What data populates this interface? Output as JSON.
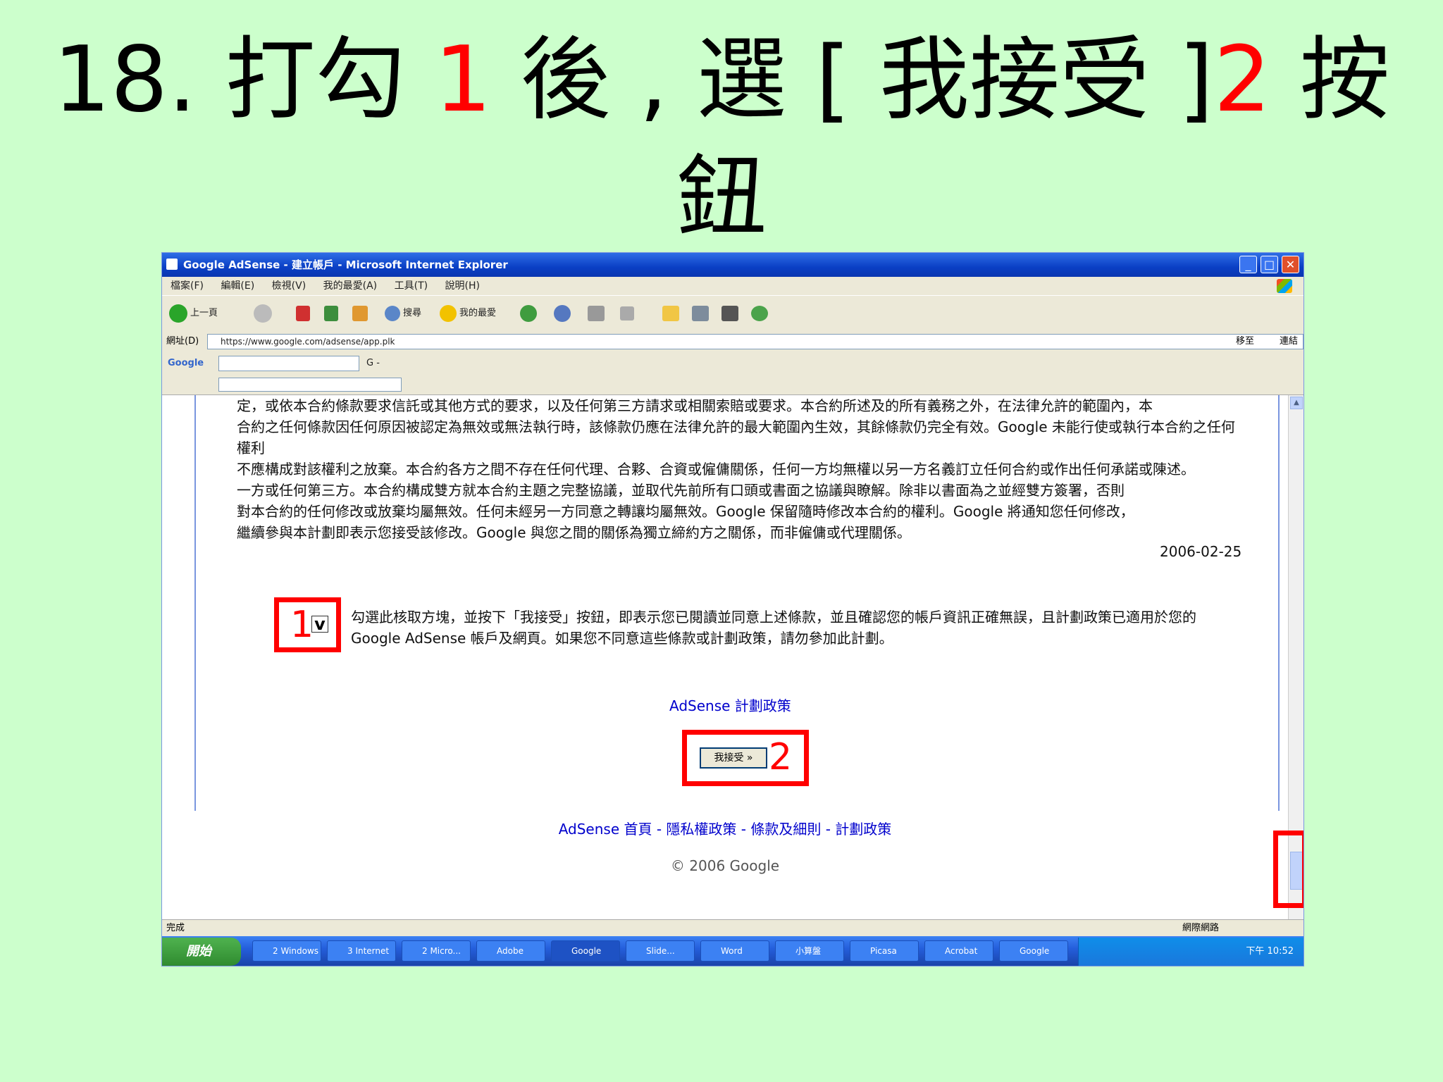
{
  "slide": {
    "title_prefix": "18. 打勾 ",
    "title_step1": "1",
    "title_middle": " 後 , 選 [ 我接受 ]",
    "title_step2": "2",
    "title_suffix": " 按",
    "title_line2": "鈕"
  },
  "window": {
    "title": "Google AdSense - 建立帳戶 - Microsoft Internet Explorer",
    "minimize": "_",
    "maximize": "□",
    "close": "✕"
  },
  "menu": [
    "檔案(F)",
    "編輯(E)",
    "檢視(V)",
    "我的最愛(A)",
    "工具(T)",
    "說明(H)"
  ],
  "toolbar": {
    "back": "上一頁",
    "search": "搜尋",
    "favorites": "我的最愛"
  },
  "address": {
    "label": "網址(D)",
    "url": "https://www.google.com/adsense/app.plk",
    "go": "移至",
    "links": "連結"
  },
  "googlebar": {
    "logo": "Google",
    "search_prefix": "G -"
  },
  "content": {
    "terms": [
      "定，或依本合約條款要求信託或其他方式的要求，以及任何第三方請求或相關索賠或要求。本合約所述及的所有義務之外，在法律允許的範圍內，本",
      "合約之任何條款因任何原因被認定為無效或無法執行時，該條款仍應在法律允許的最大範圍內生效，其餘條款仍完全有效。Google 未能行使或執行本合約之任何權利",
      "不應構成對該權利之放棄。本合約各方之間不存在任何代理、合夥、合資或僱傭關係，任何一方均無權以另一方名義訂立任何合約或作出任何承諾或陳述。",
      "一方或任何第三方。本合約構成雙方就本合約主題之完整協議，並取代先前所有口頭或書面之協議與瞭解。除非以書面為之並經雙方簽署，否則",
      "對本合約的任何修改或放棄均屬無效。任何未經另一方同意之轉讓均屬無效。Google 保留隨時修改本合約的權利。Google 將通知您任何修改，",
      "繼續參與本計劃即表示您接受該修改。Google 與您之間的關係為獨立締約方之關係，而非僱傭或代理關係。"
    ],
    "date": "2006-02-25",
    "agree_text_line1": "勾選此核取方塊，並按下「我接受」按鈕，即表示您已閱讀並同意上述條款，並且確認您的帳戶資訊正確無誤，且計劃政策已適用於您的",
    "agree_text_line2": "Google AdSense 帳戶及網頁。如果您不同意這些條款或計劃政策，請勿參加此計劃。",
    "checkbox_mark": "v",
    "marker_1": "1",
    "policy_link": "AdSense 計劃政策",
    "accept_button": "我接受 »",
    "marker_2": "2",
    "footer_links": "AdSense 首頁 - 隱私權政策 - 條款及細則 - 計劃政策",
    "copyright": "© 2006 Google"
  },
  "status": {
    "text": "完成",
    "zone": "網際網路"
  },
  "taskbar": {
    "start": "開始",
    "items": [
      "2 Windows",
      "3 Internet",
      "2 Micro...",
      "Adobe",
      "Google",
      "Slide...",
      "Word",
      "小算盤",
      "Picasa",
      "Acrobat",
      "Google"
    ],
    "clock": "下午 10:52"
  }
}
